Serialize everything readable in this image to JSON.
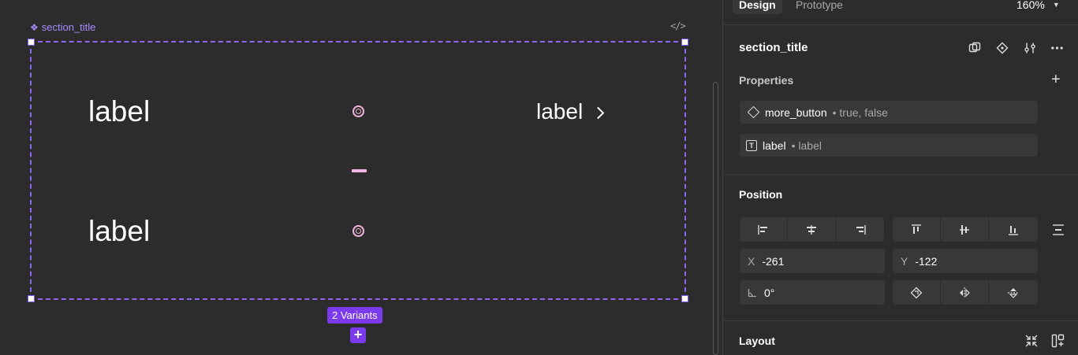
{
  "canvas": {
    "component_name": "section_title",
    "code_icon_text": "</>",
    "labels": [
      "label",
      "label"
    ],
    "right_label": "label",
    "variants_badge": "2 Variants",
    "add_variant": "+",
    "accent_color": "#7c3aed",
    "property_color": "#f3b5e0"
  },
  "panel": {
    "tabs": [
      {
        "label": "Design",
        "active": true
      },
      {
        "label": "Prototype",
        "active": false
      }
    ],
    "zoom": "160%",
    "component_title": "section_title",
    "properties": {
      "heading": "Properties",
      "items": [
        {
          "icon": "diamond-icon",
          "name": "more_button",
          "value": "• true, false"
        },
        {
          "icon": "text-icon",
          "name": "label",
          "value": "• label"
        }
      ]
    },
    "position": {
      "heading": "Position",
      "x_label": "X",
      "x_value": "-261",
      "y_label": "Y",
      "y_value": "-122",
      "rotation_value": "0°"
    },
    "layout": {
      "heading": "Layout"
    }
  }
}
